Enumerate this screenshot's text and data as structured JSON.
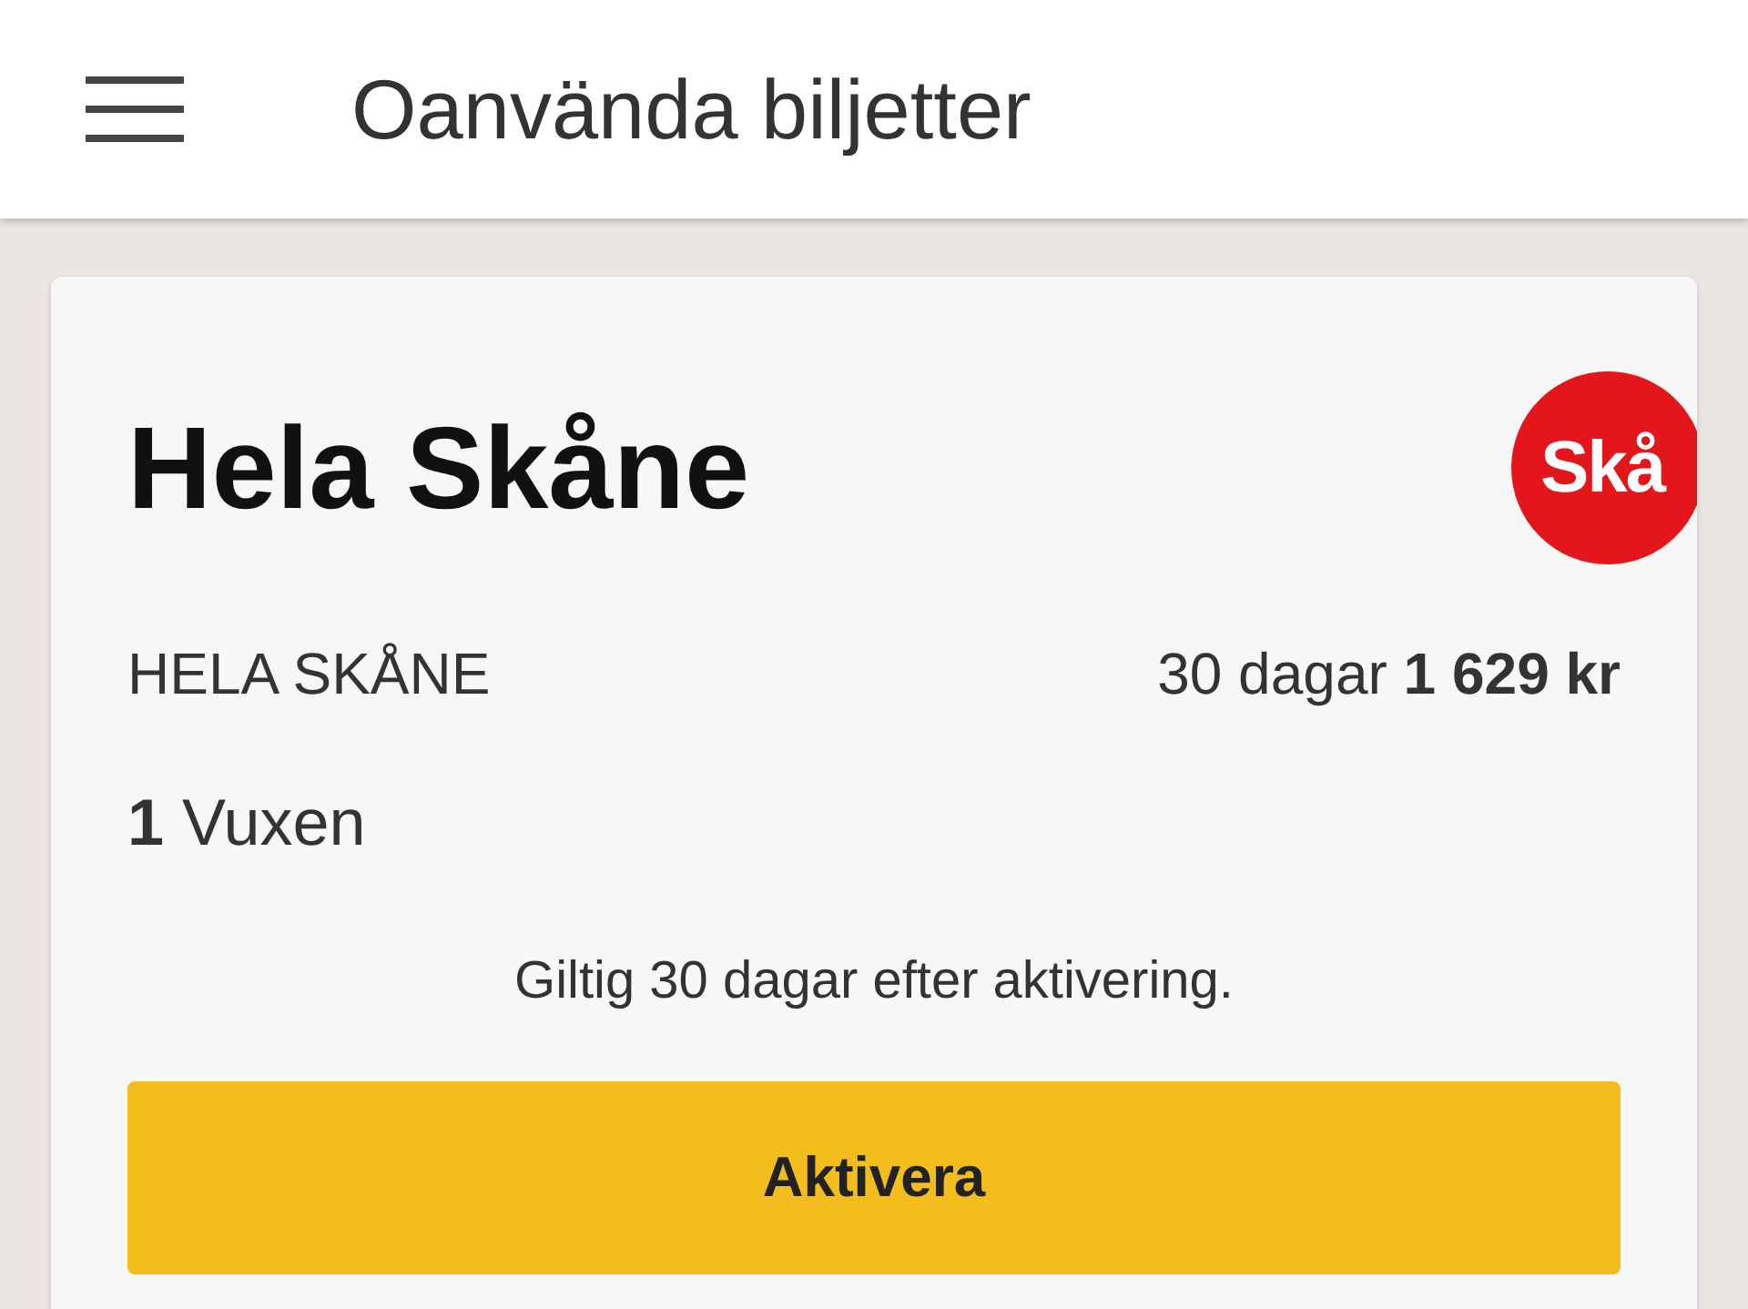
{
  "app_bar": {
    "title": "Oanvända biljetter"
  },
  "ticket": {
    "title": "Hela Skåne",
    "logo_text": "Skå",
    "zone": "HELA SKÅNE",
    "price": "30 dagar **1 629 kr**",
    "travellers": "**1** Vuxen",
    "validity": "Giltig 30 dagar efter aktivering.",
    "button": "Aktivera"
  }
}
